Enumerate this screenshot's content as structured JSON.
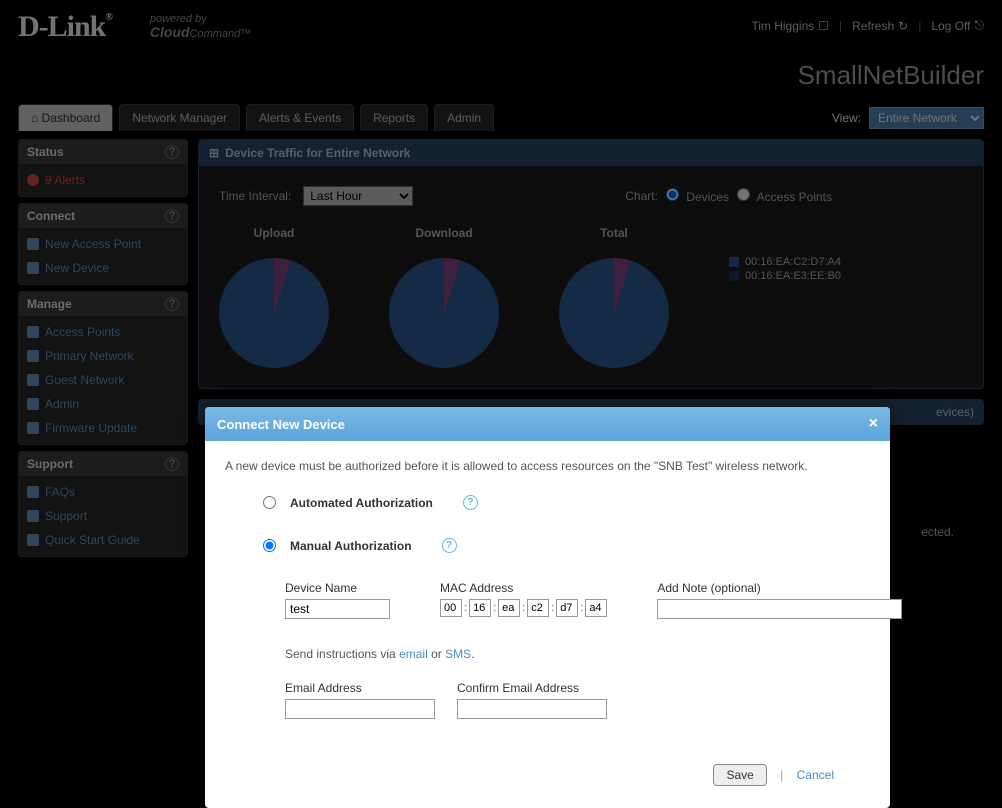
{
  "header": {
    "logo_text": "D-Link",
    "powered_by": "powered by",
    "cloud_cmd_a": "Cloud",
    "cloud_cmd_b": "Command",
    "user_name": "Tim Higgins",
    "refresh": "Refresh",
    "logoff": "Log Off",
    "site_name": "SmallNetBuilder"
  },
  "nav": {
    "tabs": [
      "Dashboard",
      "Network Manager",
      "Alerts & Events",
      "Reports",
      "Admin"
    ],
    "view_label": "View:",
    "view_value": "Entire Network"
  },
  "sidebar": {
    "status": {
      "title": "Status",
      "alerts": "9 Alerts"
    },
    "connect": {
      "title": "Connect",
      "items": [
        "New Access Point",
        "New Device"
      ]
    },
    "manage": {
      "title": "Manage",
      "items": [
        "Access Points",
        "Primary Network",
        "Guest Network",
        "Admin",
        "Firmware Update"
      ]
    },
    "support": {
      "title": "Support",
      "items": [
        "FAQs",
        "Support",
        "Quick Start Guide"
      ]
    }
  },
  "main": {
    "title": "Device Traffic for Entire Network",
    "time_label": "Time Interval:",
    "time_value": "Last Hour",
    "chart_label": "Chart:",
    "chart_opt_devices": "Devices",
    "chart_opt_aps": "Access Points",
    "charts": {
      "upload": "Upload",
      "download": "Download",
      "total": "Total"
    },
    "legend": [
      "00:16:EA:C2:D7:A4",
      "00:16:EA:E3:EE:B0"
    ],
    "visitors_panel_tail": "evices)",
    "wireless_note": "ected."
  },
  "modal": {
    "title": "Connect New Device",
    "intro": "A new device must be authorized before it is allowed to access resources on the \"SNB Test\" wireless network.",
    "auto_label": "Automated Authorization",
    "manual_label": "Manual Authorization",
    "device_name_label": "Device Name",
    "device_name_value": "test",
    "mac_label": "MAC Address",
    "mac": [
      "00",
      "16",
      "ea",
      "c2",
      "d7",
      "a4"
    ],
    "note_label": "Add Note (optional)",
    "note_value": "",
    "send_label": "Send instructions via ",
    "email_link": "email",
    "or_text": " or ",
    "sms_link": "SMS",
    "period": ".",
    "email_label": "Email Address",
    "confirm_email_label": "Confirm Email Address",
    "save": "Save",
    "cancel": "Cancel"
  }
}
